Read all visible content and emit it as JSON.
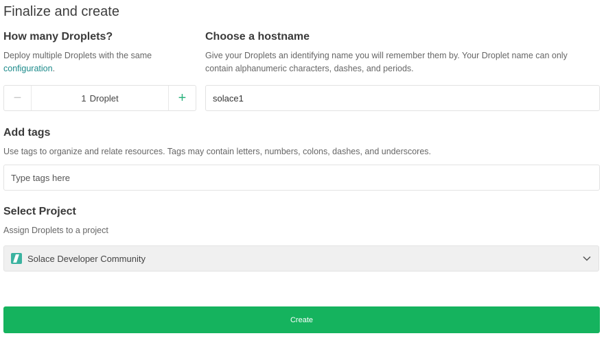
{
  "page": {
    "title": "Finalize and create"
  },
  "droplets": {
    "heading": "How many Droplets?",
    "desc_prefix": "Deploy multiple Droplets with the same",
    "desc_link": "configuration",
    "desc_suffix": ".",
    "count": "1",
    "unit": "Droplet",
    "minus_symbol": "−",
    "plus_symbol": "+"
  },
  "hostname": {
    "heading": "Choose a hostname",
    "desc_line1": "Give your Droplets an identifying name you will remember them by. Your Droplet name can only",
    "desc_line2": "contain alphanumeric characters, dashes, and periods.",
    "value": "solace1"
  },
  "tags": {
    "heading": "Add tags",
    "desc": "Use tags to organize and relate resources. Tags may contain letters, numbers, colons, dashes, and underscores.",
    "placeholder": "Type tags here"
  },
  "project": {
    "heading": "Select Project",
    "desc": "Assign Droplets to a project",
    "selected": "Solace Developer Community",
    "icon": "project-icon"
  },
  "actions": {
    "create_label": "Create"
  },
  "colors": {
    "accent_green": "#15b35e",
    "link": "#1b8a8a",
    "plus": "#2bb37e"
  }
}
